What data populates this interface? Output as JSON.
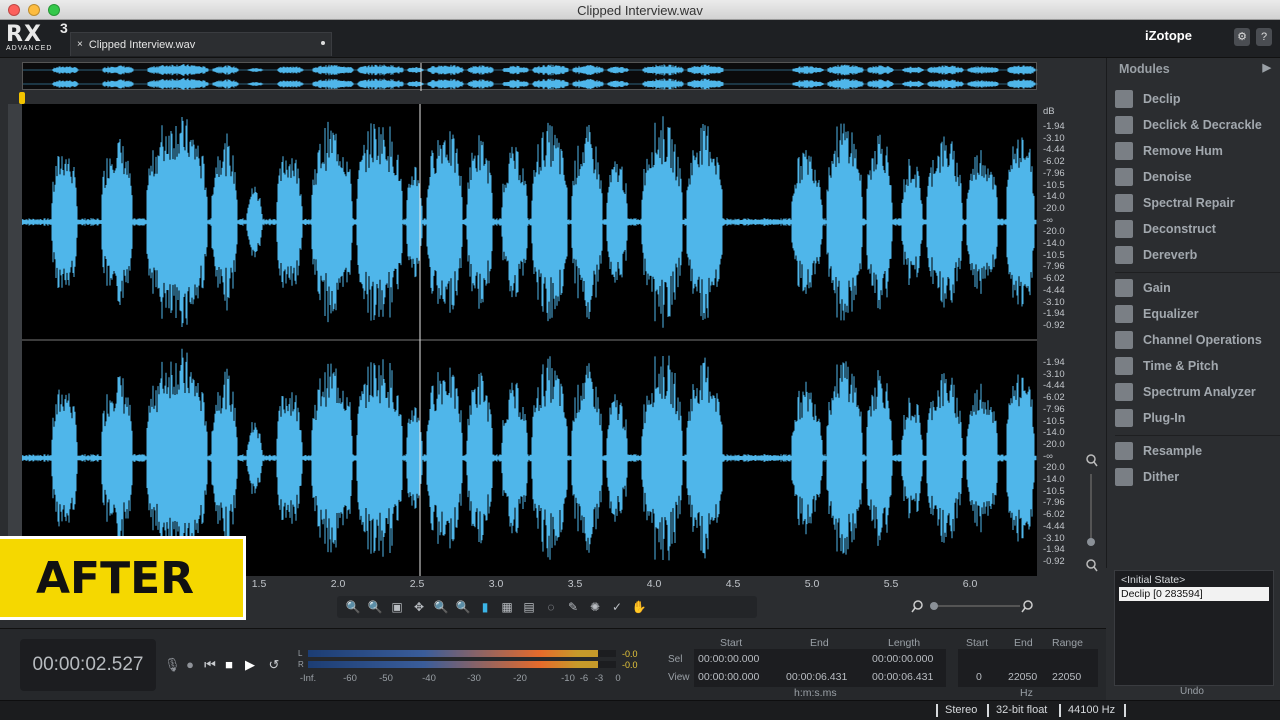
{
  "window": {
    "title": "Clipped Interview.wav"
  },
  "header": {
    "logo_rx": "RX",
    "logo_version": "3",
    "logo_edition": "ADVANCED",
    "tab_close": "×",
    "tab_label": "Clipped Interview.wav",
    "brand": "iZotope",
    "settings_btn": "⚙",
    "help_btn": "?"
  },
  "db_scale_top": {
    "unit": "dB",
    "ticks": [
      "-1.94",
      "-3.10",
      "-4.44",
      "-6.02",
      "-7.96",
      "-10.5",
      "-14.0",
      "-20.0",
      "-∞",
      "-20.0",
      "-14.0",
      "-10.5",
      "-7.96",
      "-6.02",
      "-4.44",
      "-3.10",
      "-1.94",
      "-0.92"
    ]
  },
  "db_scale_bottom": {
    "ticks": [
      "-1.94",
      "-3.10",
      "-4.44",
      "-6.02",
      "-7.96",
      "-10.5",
      "-14.0",
      "-20.0",
      "-∞",
      "-20.0",
      "-14.0",
      "-10.5",
      "-7.96",
      "-6.02",
      "-4.44",
      "-3.10",
      "-1.94",
      "-0.92"
    ]
  },
  "time_axis": {
    "labels": [
      "1.5",
      "2.0",
      "2.5",
      "3.0",
      "3.5",
      "4.0",
      "4.5",
      "5.0",
      "5.5",
      "6.0"
    ]
  },
  "overlay": {
    "label": "AFTER"
  },
  "toolbar": {
    "tools": [
      "🔍",
      "🔍",
      "▣",
      "✥",
      "🔍",
      "🔍",
      "▮",
      "▦",
      "▤",
      "◌",
      "✎",
      "✺",
      "✓",
      "✋"
    ]
  },
  "modules": {
    "header": "Modules",
    "header_arrow": "▶",
    "groups": [
      [
        {
          "label": "Declip",
          "icon": "declip-icon"
        },
        {
          "label": "Declick & Decrackle",
          "icon": "declick-icon"
        },
        {
          "label": "Remove Hum",
          "icon": "hum-icon"
        },
        {
          "label": "Denoise",
          "icon": "denoise-icon"
        },
        {
          "label": "Spectral Repair",
          "icon": "spectral-repair-icon"
        },
        {
          "label": "Deconstruct",
          "icon": "deconstruct-icon"
        },
        {
          "label": "Dereverb",
          "icon": "dereverb-icon"
        }
      ],
      [
        {
          "label": "Gain",
          "icon": "gain-icon"
        },
        {
          "label": "Equalizer",
          "icon": "equalizer-icon"
        },
        {
          "label": "Channel Operations",
          "icon": "channel-ops-icon"
        },
        {
          "label": "Time & Pitch",
          "icon": "time-pitch-icon"
        },
        {
          "label": "Spectrum Analyzer",
          "icon": "spectrum-icon"
        },
        {
          "label": "Plug-In",
          "icon": "plugin-icon"
        }
      ],
      [
        {
          "label": "Resample",
          "icon": "resample-icon"
        },
        {
          "label": "Dither",
          "icon": "dither-icon"
        }
      ]
    ]
  },
  "history": {
    "items": [
      "<Initial State>",
      "Declip [0 283594]"
    ],
    "undo_label": "Undo"
  },
  "transport": {
    "time": "00:00:02.527",
    "meter": {
      "left_label": "L",
      "right_label": "R",
      "peak_l": "-0.0",
      "peak_r": "-0.0",
      "level_l": 0.94,
      "level_r": 0.94,
      "scale": [
        "-Inf.",
        "-60",
        "-50",
        "-40",
        "-30",
        "-20",
        "-10",
        "-6",
        "-3",
        "0"
      ]
    }
  },
  "selection": {
    "headers": {
      "start": "Start",
      "end": "End",
      "length": "Length"
    },
    "sel_label": "Sel",
    "view_label": "View",
    "sel": {
      "start": "00:00:00.000",
      "end": "",
      "length": "00:00:00.000"
    },
    "view": {
      "start": "00:00:00.000",
      "end": "00:00:06.431",
      "length": "00:00:06.431"
    },
    "unit": "h:m:s.ms"
  },
  "frequency": {
    "headers": {
      "start": "Start",
      "end": "End",
      "range": "Range"
    },
    "values": {
      "start": "0",
      "end": "22050",
      "range": "22050"
    },
    "unit": "Hz"
  },
  "status": {
    "channels": "Stereo",
    "bit_depth": "32-bit float",
    "sample_rate": "44100 Hz"
  },
  "colors": {
    "waveform": "#4fb6ea",
    "after_label": "#f5d800",
    "cursor": "#f2c300"
  }
}
